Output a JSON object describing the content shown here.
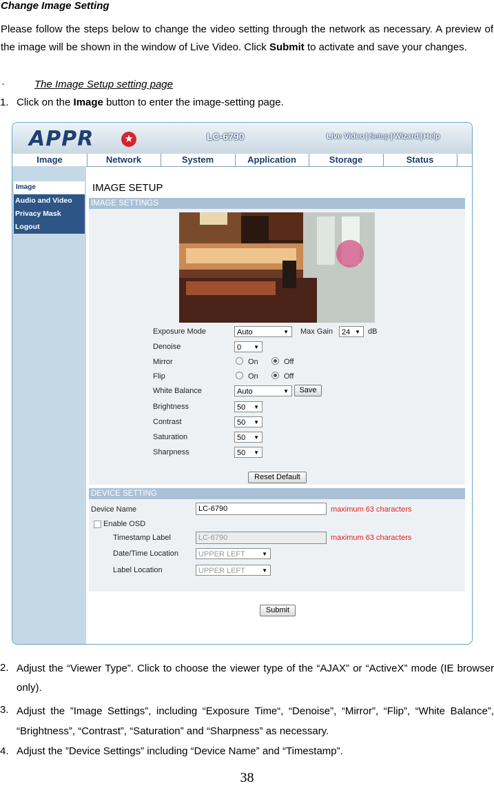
{
  "doc": {
    "title": "Change Image Setting",
    "intro_a": "Please follow the steps below to change the video setting through the network as necessary. A preview of the image will be shown in the window of Live Video. Click ",
    "intro_bold": "Submit",
    "intro_b": " to activate and save your changes.",
    "bullet_symbol": "·",
    "bullet_text": "The Image Setup setting page",
    "step1_num": "1.",
    "step1_a": "Click on the ",
    "step1_bold": "Image",
    "step1_b": " button to enter the image-setting page.",
    "step2_num": "2.",
    "step2": "Adjust the “Viewer Type”. Click to choose the viewer type of the “AJAX” or “ActiveX” mode (IE browser only).",
    "step3_num": "3.",
    "step3": "Adjust the ”Image Settings”, including “Exposure Time“, “Denoise”, “Mirror”, “Flip”, “White Balance”, “Brightness”, “Contrast”, “Saturation” and “Sharpness” as necessary.",
    "step4_num": "4.",
    "step4": "Adjust the ”Device Settings” including “Device Name” and “Timestamp”.",
    "page_number": "38"
  },
  "ui": {
    "logo": "APPR",
    "logo_star": "★",
    "model": "LC-6790",
    "top_links": [
      "Live Video",
      "Setup",
      "Wizard",
      "Help"
    ],
    "top_sep": "|",
    "nav": [
      "Image",
      "Network",
      "System",
      "Application",
      "Storage",
      "Status"
    ],
    "sidebar_selected": "Image",
    "sidebar_items": [
      "Audio and Video",
      "Privacy Mask",
      "Logout"
    ],
    "page_heading": "IMAGE SETUP",
    "image_settings_header": "IMAGE SETTINGS",
    "fields": {
      "exposure_label": "Exposure Mode",
      "exposure_value": "Auto",
      "maxgain_label": "Max Gain",
      "maxgain_value": "24",
      "maxgain_unit": "dB",
      "denoise_label": "Denoise",
      "denoise_value": "0",
      "mirror_label": "Mirror",
      "flip_label": "Flip",
      "on_label": "On",
      "off_label": "Off",
      "wb_label": "White Balance",
      "wb_value": "Auto",
      "save_label": "Save",
      "brightness_label": "Brightness",
      "brightness_value": "50",
      "contrast_label": "Contrast",
      "contrast_value": "50",
      "saturation_label": "Saturation",
      "saturation_value": "50",
      "sharpness_label": "Sharpness",
      "sharpness_value": "50",
      "reset_label": "Reset Default"
    },
    "device_header": "DEVICE SETTING",
    "device": {
      "name_label": "Device Name",
      "name_value": "LC-6790",
      "max_chars": "maximum 63 characters",
      "osd_label": "Enable OSD",
      "ts_label": "Timestamp Label",
      "ts_value": "LC-6790",
      "dt_loc_label": "Date/Time Location",
      "dt_loc_value": "UPPER LEFT",
      "label_loc_label": "Label Location",
      "label_loc_value": "UPPER LEFT"
    },
    "submit_label": "Submit",
    "arrow": "▼"
  }
}
